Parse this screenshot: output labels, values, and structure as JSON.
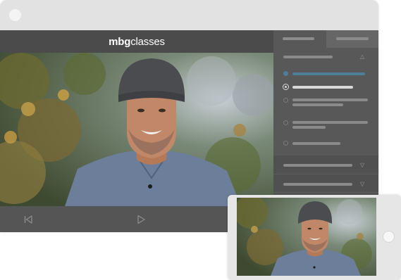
{
  "app": {
    "brand_bold": "mbg",
    "brand_rest": "classes"
  },
  "player": {
    "icons": [
      "skip-back-icon",
      "play-icon"
    ]
  },
  "sidebar": {
    "tabs": [
      "lessons-tab",
      "notes-tab"
    ],
    "lesson_states": [
      "playing",
      "current",
      "locked",
      "locked",
      "locked"
    ],
    "sections_below": 2
  },
  "colors": {
    "desktop_frame": "#e2e2e2",
    "header": "#4b4b4b",
    "player_bar": "#555555",
    "sidebar": "#585858",
    "accent_playing": "#4f7e9b",
    "text_light": "#ffffff"
  }
}
